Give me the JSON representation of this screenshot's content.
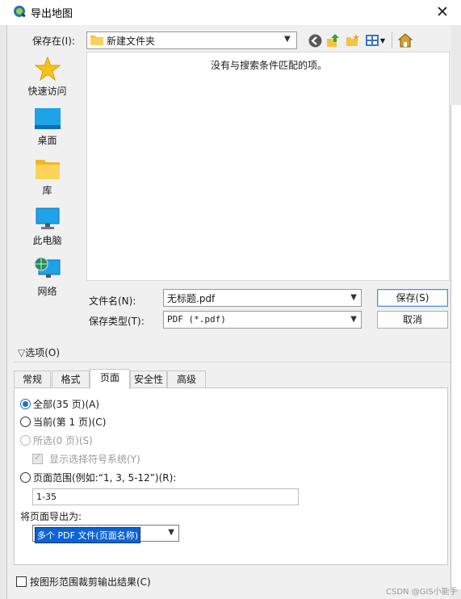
{
  "window": {
    "title": "导出地图"
  },
  "save_in": {
    "label": "保存在(I):",
    "value": "新建文件夹"
  },
  "places": [
    {
      "label": "快速访问",
      "icon": "star-icon"
    },
    {
      "label": "桌面",
      "icon": "desktop-icon"
    },
    {
      "label": "库",
      "icon": "library-folder-icon"
    },
    {
      "label": "此电脑",
      "icon": "computer-icon"
    },
    {
      "label": "网络",
      "icon": "network-icon"
    }
  ],
  "file_list": {
    "empty_message": "没有与搜索条件匹配的项。"
  },
  "file_name": {
    "label": "文件名(N):",
    "value": "无标题.pdf"
  },
  "file_type": {
    "label": "保存类型(T):",
    "value": "PDF (*.pdf)"
  },
  "buttons": {
    "save": "保存(S)",
    "cancel": "取消"
  },
  "options": {
    "toggle_label": "选项(O)"
  },
  "tabs": [
    {
      "label": "常规",
      "active": false
    },
    {
      "label": "格式",
      "active": false
    },
    {
      "label": "页面",
      "active": true
    },
    {
      "label": "安全性",
      "active": false
    },
    {
      "label": "高级",
      "active": false
    }
  ],
  "page_options": {
    "all": "全部(35 页)(A)",
    "current": "当前(第 1 页)(C)",
    "selected": "所选(0 页)(S)",
    "show_selection_symbology": "显示选择符号系统(Y)",
    "page_range": "页面范围(例如:“1, 3, 5-12”)(R):",
    "range_value": "1-35",
    "export_as_label": "将页面导出为:",
    "export_as_value": "多个 PDF 文件(页面名称)"
  },
  "clip_to_graphics": "按图形范围裁剪输出结果(C)",
  "watermark": "CSDN @GIS小能手",
  "colors": {
    "accent": "#1f6fc5",
    "selection": "#0a64d6"
  }
}
